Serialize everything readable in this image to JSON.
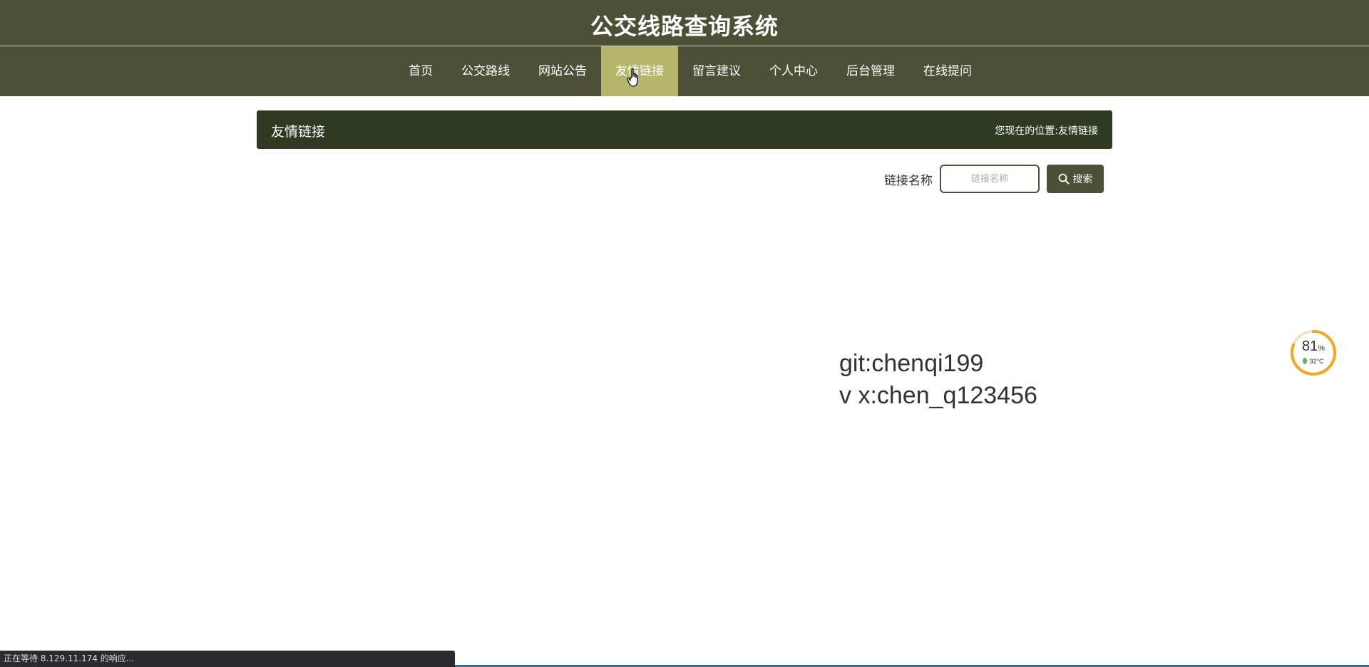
{
  "header": {
    "site_title": "公交线路查询系统"
  },
  "nav": {
    "items": [
      {
        "label": "首页",
        "active": false
      },
      {
        "label": "公交路线",
        "active": false
      },
      {
        "label": "网站公告",
        "active": false
      },
      {
        "label": "友情链接",
        "active": true
      },
      {
        "label": "留言建议",
        "active": false
      },
      {
        "label": "个人中心",
        "active": false
      },
      {
        "label": "后台管理",
        "active": false
      },
      {
        "label": "在线提问",
        "active": false
      }
    ]
  },
  "panel": {
    "title": "友情链接",
    "breadcrumb_prefix": "您现在的位置:",
    "breadcrumb_current": "友情链接"
  },
  "search": {
    "label": "链接名称",
    "placeholder": "链接名称",
    "button_label": "搜索"
  },
  "watermark": {
    "line1": "git:chenqi199",
    "line2": "v x:chen_q123456"
  },
  "gauge": {
    "percent": "81",
    "percent_unit": "%",
    "temperature": "32°C",
    "accent_color": "#f5a623"
  },
  "status_bar": {
    "text": "正在等待 8.129.11.174 的响应..."
  },
  "colors": {
    "header_bg": "#4d4f36",
    "nav_active_bg": "#b5b56c",
    "panel_bg": "#2f3a22"
  }
}
